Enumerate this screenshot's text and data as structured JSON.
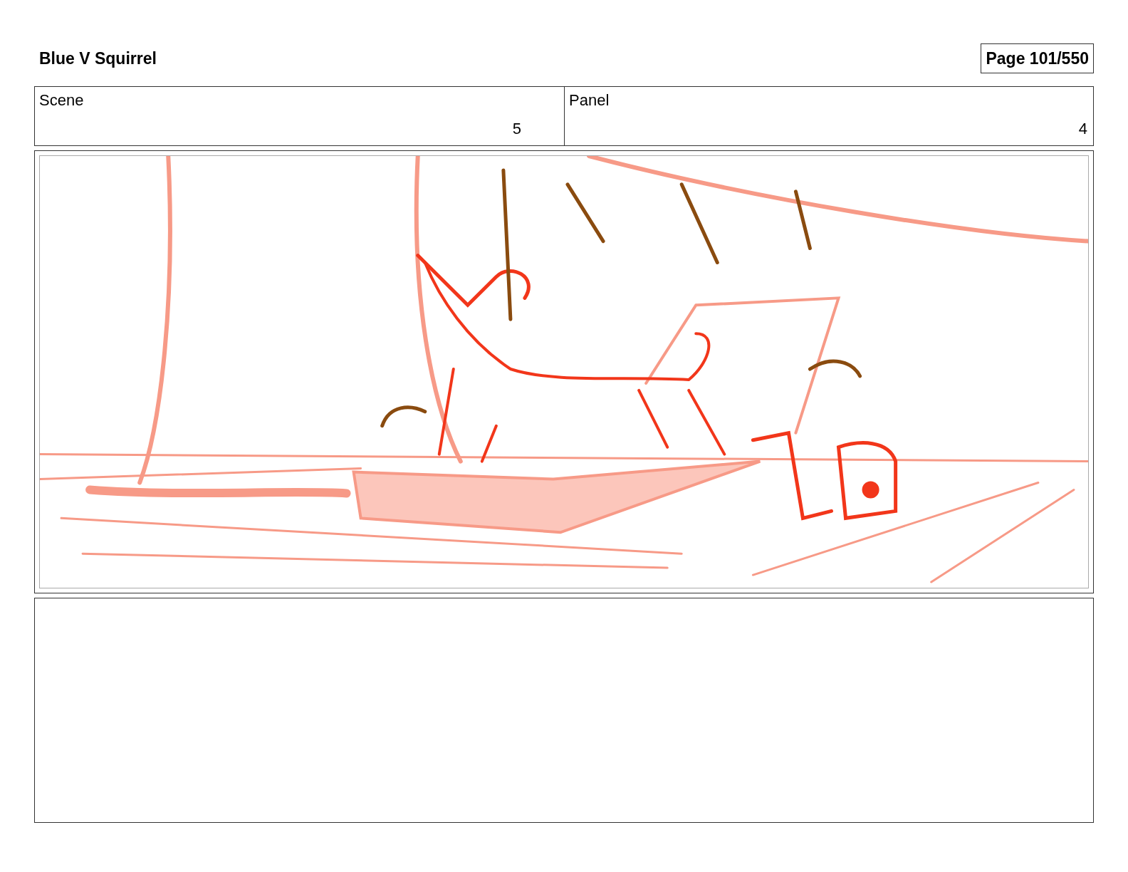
{
  "header": {
    "title": "Blue V Squirrel",
    "page": "Page 101/550"
  },
  "fields": [
    {
      "label": "Scene",
      "value": "5"
    },
    {
      "label": "Panel",
      "value": "4"
    }
  ]
}
